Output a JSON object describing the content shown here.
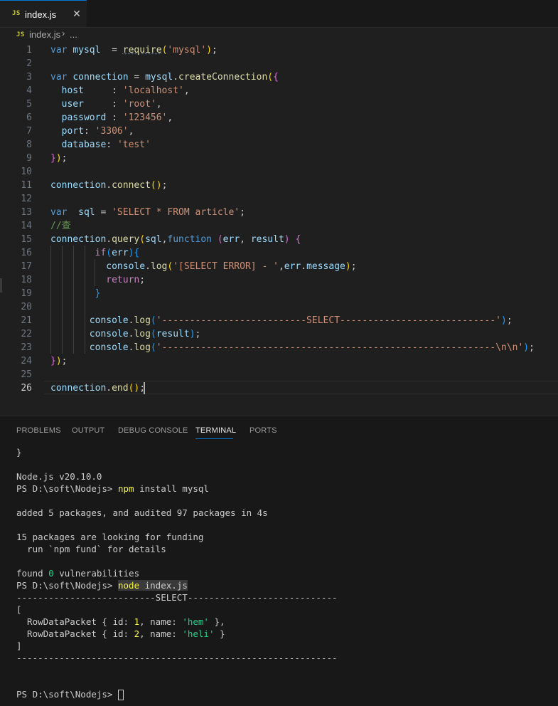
{
  "tab": {
    "badge": "JS",
    "label": "index.js",
    "close": "✕"
  },
  "breadcrumb": {
    "badge": "JS",
    "file": "index.js",
    "sep": "›",
    "more": "..."
  },
  "editor": {
    "lines": [
      {
        "n": "1",
        "html": "<span class=\"kw\">var</span> <span class=\"vr\">mysql</span>  = <span class=\"fn\" style=\"text-decoration:underline dotted #6e7681\">require</span><span class=\"b1\">(</span><span class=\"st\">'mysql'</span><span class=\"b1\">)</span>;"
      },
      {
        "n": "2",
        "html": ""
      },
      {
        "n": "3",
        "html": "<span class=\"kw\">var</span> <span class=\"vr\">connection</span> = <span class=\"vr\">mysql</span>.<span class=\"fn\">createConnection</span><span class=\"b1\">(</span><span class=\"b2\">{</span>"
      },
      {
        "n": "4",
        "html": "  <span class=\"vr\">host</span>     : <span class=\"st\">'localhost'</span>,"
      },
      {
        "n": "5",
        "html": "  <span class=\"vr\">user</span>     : <span class=\"st\">'root'</span>,"
      },
      {
        "n": "6",
        "html": "  <span class=\"vr\">password</span> : <span class=\"st\">'123456'</span>,"
      },
      {
        "n": "7",
        "html": "  <span class=\"vr\">port</span>: <span class=\"st\">'3306'</span>,"
      },
      {
        "n": "8",
        "html": "  <span class=\"vr\">database</span>: <span class=\"st\">'test'</span>"
      },
      {
        "n": "9",
        "html": "<span class=\"b2\">}</span><span class=\"b1\">)</span>;"
      },
      {
        "n": "10",
        "html": ""
      },
      {
        "n": "11",
        "html": "<span class=\"vr\">connection</span>.<span class=\"fn\">connect</span><span class=\"b1\">()</span>;"
      },
      {
        "n": "12",
        "html": ""
      },
      {
        "n": "13",
        "html": "<span class=\"kw\">var</span>  <span class=\"vr\">sql</span> = <span class=\"st\">'SELECT * FROM article'</span>;"
      },
      {
        "n": "14",
        "html": "<span class=\"cm\">//查</span>"
      },
      {
        "n": "15",
        "html": "<span class=\"vr\">connection</span>.<span class=\"fn\">query</span><span class=\"b1\">(</span><span class=\"vr\">sql</span>,<span class=\"kw\">function</span> <span class=\"b2\">(</span><span class=\"vr\">err</span>, <span class=\"vr\">result</span><span class=\"b2\">)</span> <span class=\"b2\">{</span>"
      },
      {
        "n": "16",
        "html": "        <span class=\"ctl\">if</span><span class=\"b3\">(</span><span class=\"vr\">err</span><span class=\"b3\">)</span><span class=\"b3\">{</span>"
      },
      {
        "n": "17",
        "html": "          <span class=\"vr\">console</span>.<span class=\"fn\">log</span><span class=\"b1\">(</span><span class=\"st\">'[SELECT ERROR] - '</span>,<span class=\"vr\">err</span>.<span class=\"vr\">message</span><span class=\"b1\">)</span>;"
      },
      {
        "n": "18",
        "html": "          <span class=\"ctl\">return</span>;"
      },
      {
        "n": "19",
        "html": "        <span class=\"b3\">}</span>"
      },
      {
        "n": "20",
        "html": ""
      },
      {
        "n": "21",
        "html": "       <span class=\"vr\">console</span>.<span class=\"fn\">log</span><span class=\"b3\">(</span><span class=\"st\">'--------------------------SELECT----------------------------'</span><span class=\"b3\">)</span>;"
      },
      {
        "n": "22",
        "html": "       <span class=\"vr\">console</span>.<span class=\"fn\">log</span><span class=\"b3\">(</span><span class=\"vr\">result</span><span class=\"b3\">)</span>;"
      },
      {
        "n": "23",
        "html": "       <span class=\"vr\">console</span>.<span class=\"fn\">log</span><span class=\"b3\">(</span><span class=\"st\">'------------------------------------------------------------\\n\\n'</span><span class=\"b3\">)</span>;"
      },
      {
        "n": "24",
        "html": "<span class=\"b2\">}</span><span class=\"b1\">)</span>;"
      },
      {
        "n": "25",
        "html": ""
      },
      {
        "n": "26",
        "html": "<span class=\"vr\">connection</span>.<span class=\"fn\">end</span><span class=\"b1\">()</span>;"
      }
    ]
  },
  "panel": {
    "tabs": [
      "PROBLEMS",
      "OUTPUT",
      "DEBUG CONSOLE",
      "TERMINAL",
      "PORTS"
    ],
    "active_tab": "TERMINAL"
  },
  "terminal": {
    "lines": [
      {
        "html": "}"
      },
      {
        "html": ""
      },
      {
        "html": "Node.js v20.10.0"
      },
      {
        "html": "PS D:\\soft\\Nodejs&gt; <span class=\"y\">npm</span> install mysql"
      },
      {
        "html": ""
      },
      {
        "html": "added 5 packages, and audited 97 packages in 4s"
      },
      {
        "html": ""
      },
      {
        "html": "15 packages are looking for funding"
      },
      {
        "html": "  run `npm fund` for details"
      },
      {
        "html": ""
      },
      {
        "html": "found <span class=\"g\">0</span> vulnerabilities"
      },
      {
        "html": "PS D:\\soft\\Nodejs&gt; <span class=\"y hl\">node</span><span class=\"hl\"> index.js</span>"
      },
      {
        "html": "--------------------------SELECT----------------------------"
      },
      {
        "html": "["
      },
      {
        "html": "  RowDataPacket { id: <span class=\"c-num\">1</span>, name: <span class=\"g\">'hem'</span> },"
      },
      {
        "html": "  RowDataPacket { id: <span class=\"c-num\">2</span>, name: <span class=\"g\">'heli'</span> }"
      },
      {
        "html": "]"
      },
      {
        "html": "------------------------------------------------------------"
      },
      {
        "html": ""
      },
      {
        "html": ""
      },
      {
        "html": "PS D:\\soft\\Nodejs&gt; <span class=\"tcursor\"></span>"
      }
    ]
  }
}
